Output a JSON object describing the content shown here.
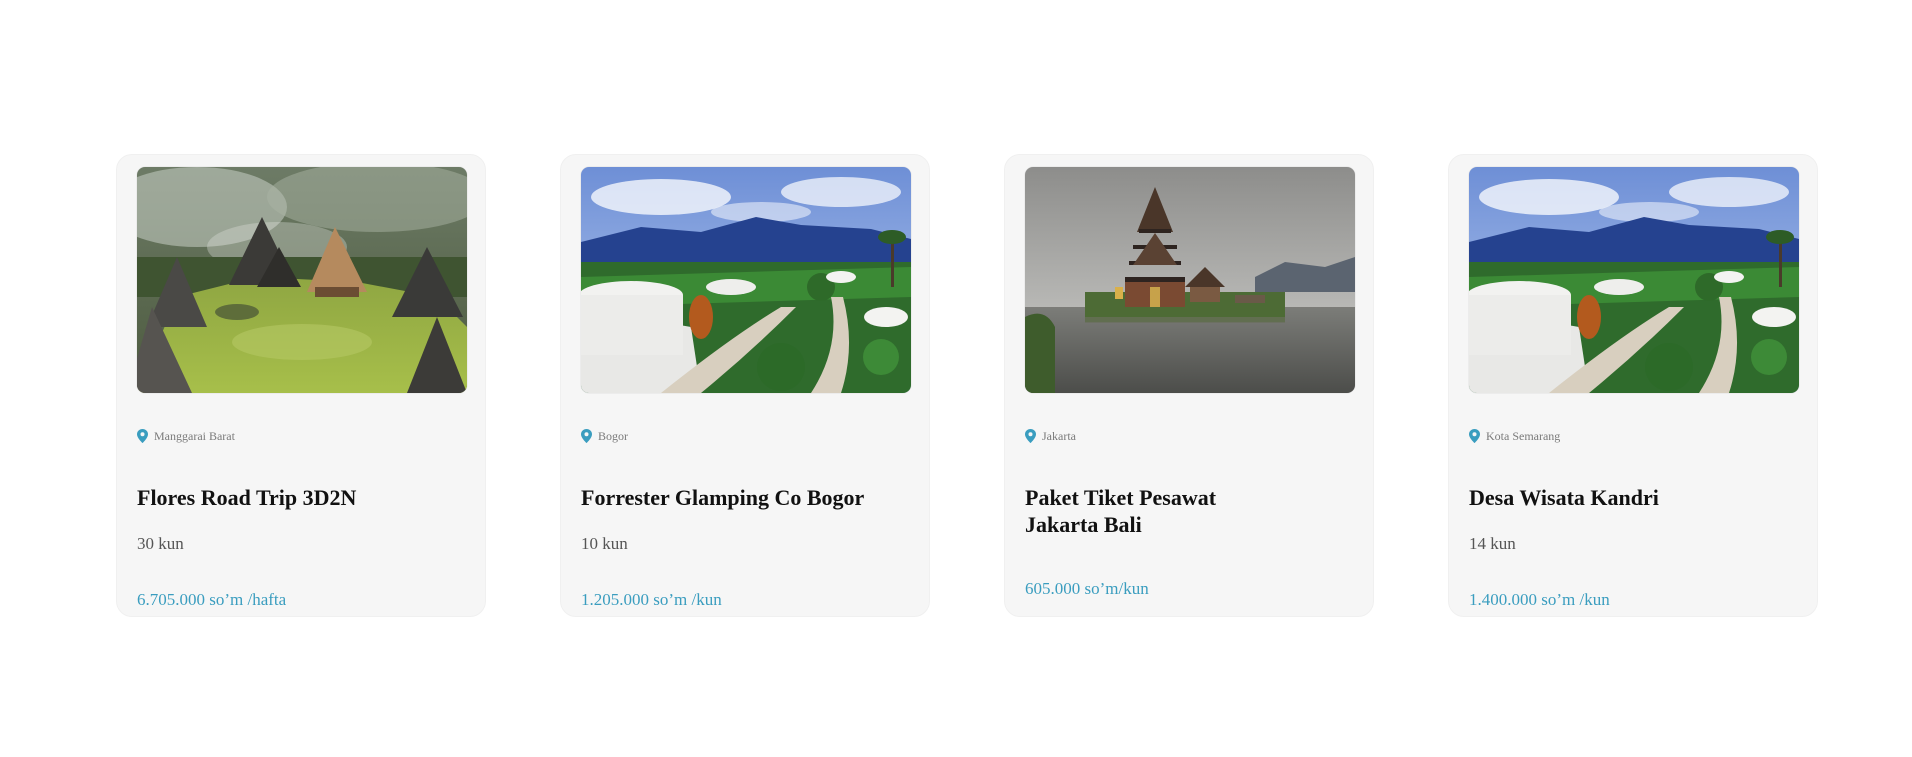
{
  "accent_color": "#3a9dbf",
  "cards": [
    {
      "image_icon": "village-photo",
      "location": "Manggarai Barat",
      "title": "Flores Road Trip 3D2N",
      "duration": "30 kun",
      "price": "6.705.000 so’m /hafta"
    },
    {
      "image_icon": "glamping-photo",
      "location": "Bogor",
      "title": "Forrester Glamping Co Bogor",
      "duration": "10 kun",
      "price": "1.205.000 so’m /kun"
    },
    {
      "image_icon": "temple-photo",
      "location": "Jakarta",
      "title_line1": "Paket Tiket Pesawat",
      "title_line2": "Jakarta Bali",
      "duration": "",
      "price": "605.000 so’m/kun"
    },
    {
      "image_icon": "glamping-photo",
      "location": "Kota Semarang",
      "title": "Desa Wisata Kandri",
      "duration": "14 kun",
      "price": "1.400.000 so’m /kun"
    }
  ]
}
